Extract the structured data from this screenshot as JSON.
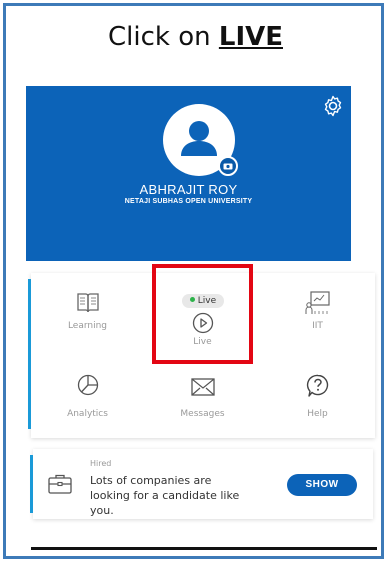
{
  "instruction": {
    "prefix": "Click on ",
    "emphasis": "LIVE"
  },
  "profile": {
    "name": "ABHRAJIT ROY",
    "university": "NETAJI SUBHAS OPEN UNIVERSITY"
  },
  "menu": {
    "learning": "Learning",
    "live_badge": "Live",
    "live": "Live",
    "iit": "IIT",
    "analytics": "Analytics",
    "messages": "Messages",
    "help": "Help"
  },
  "hired_card": {
    "label": "Hired",
    "text": "Lots of companies are looking for a candidate like you.",
    "button": "SHOW"
  },
  "colors": {
    "brand_blue": "#0c63b8",
    "accent_cyan": "#1a9ad8",
    "highlight_red": "#e30613",
    "live_green": "#2db34a"
  }
}
